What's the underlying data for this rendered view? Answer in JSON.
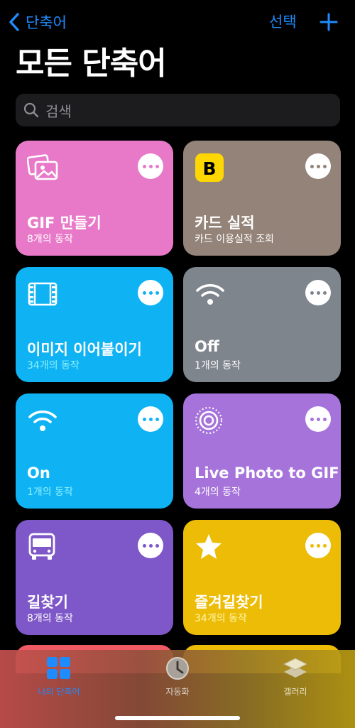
{
  "nav": {
    "back_label": "단축어",
    "select_label": "선택"
  },
  "header": {
    "title": "모든 단축어"
  },
  "search": {
    "placeholder": "검색"
  },
  "shortcuts": [
    {
      "title": "GIF 만들기",
      "subtitle": "8개의 동작",
      "color": "#e879c8",
      "icon": "photos-icon"
    },
    {
      "title": "카드 실적",
      "subtitle": "카드 이용실적 조회",
      "color": "#948378",
      "icon": "app-b-icon"
    },
    {
      "title": "이미지 이어붙이기",
      "subtitle": "34개의 동작",
      "color": "#0fb3f3",
      "icon": "film-icon"
    },
    {
      "title": "Off",
      "subtitle": "1개의 동작",
      "color": "#7f858d",
      "icon": "wifi-icon"
    },
    {
      "title": "On",
      "subtitle": "1개의 동작",
      "color": "#0fb3f3",
      "icon": "wifi-icon"
    },
    {
      "title": "Live Photo to GIF",
      "subtitle": "4개의 동작",
      "color": "#a673db",
      "icon": "live-photo-icon"
    },
    {
      "title": "길찾기",
      "subtitle": "8개의 동작",
      "color": "#7e57c8",
      "icon": "bus-icon"
    },
    {
      "title": "즐겨길찾기",
      "subtitle": "34개의 동작",
      "color": "#ecbc06",
      "icon": "star-icon"
    }
  ],
  "tabs": [
    {
      "label": "나의 단축어",
      "icon": "grid-icon",
      "selected": true
    },
    {
      "label": "자동화",
      "icon": "clock-icon",
      "selected": false
    },
    {
      "label": "갤러리",
      "icon": "layers-icon",
      "selected": false
    }
  ],
  "colors": {
    "accent": "#1e8cff",
    "background": "#000000"
  }
}
